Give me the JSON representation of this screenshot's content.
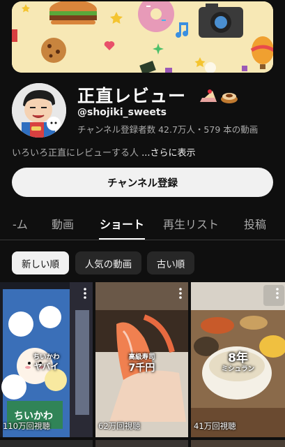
{
  "channel": {
    "name": "正直レビュー",
    "handle": "@shojiki_sweets",
    "stats": "チャンネル登録者数 42.7万人・579 本の動画",
    "description": "いろいろ正直にレビューする人",
    "more_label": " ...さらに表示",
    "subscribe_label": "チャンネル登録"
  },
  "tabs": [
    {
      "label": "-ム"
    },
    {
      "label": "動画"
    },
    {
      "label": "ショート",
      "active": true
    },
    {
      "label": "再生リスト"
    },
    {
      "label": "投稿"
    }
  ],
  "chips": [
    {
      "label": "新しい順",
      "active": true
    },
    {
      "label": "人気の動画"
    },
    {
      "label": "古い順"
    }
  ],
  "shorts": [
    {
      "views": "110万回視聴",
      "overlay_small": "ちいかわ",
      "overlay_big": "ヤバイ"
    },
    {
      "views": "62万回視聴",
      "overlay_small": "高級寿司",
      "overlay_big": "7千円"
    },
    {
      "views": "41万回視聴",
      "overlay_small": "ミシュラン",
      "overlay_big": "8年"
    }
  ]
}
